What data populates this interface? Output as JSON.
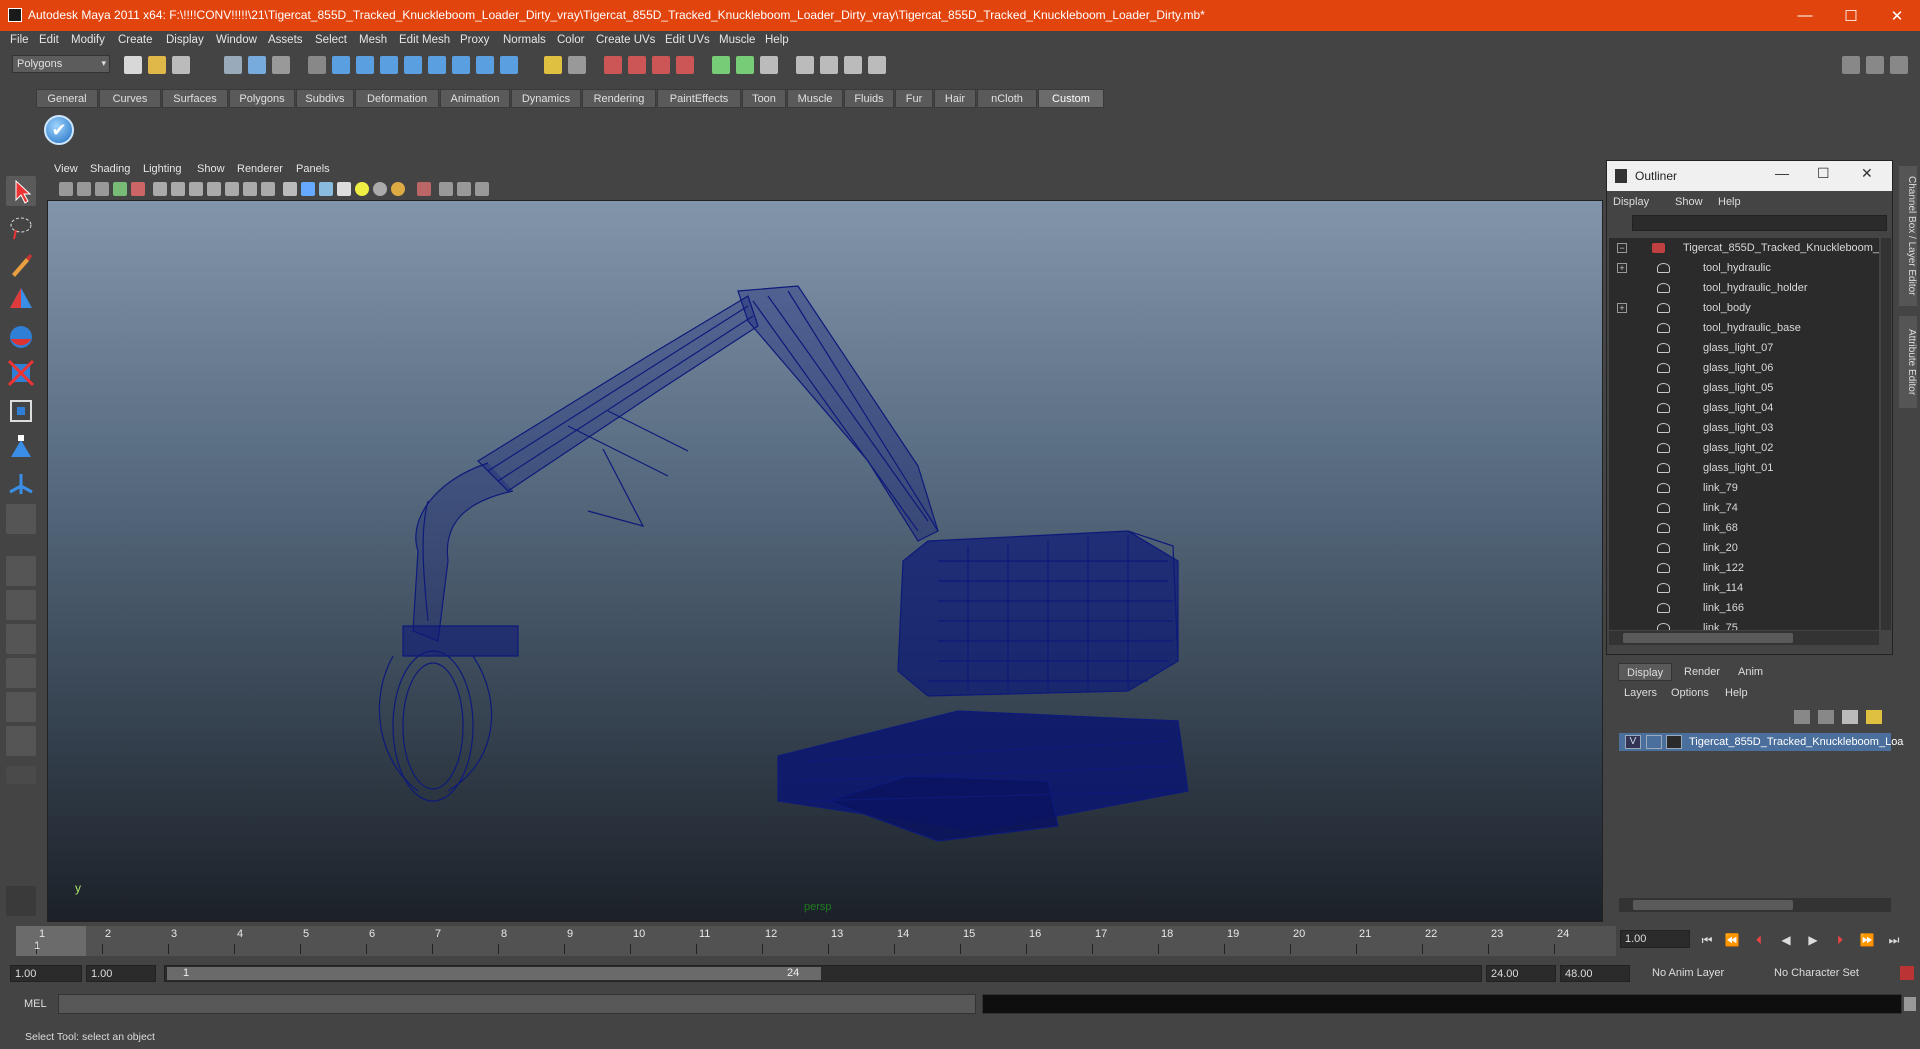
{
  "window": {
    "title": "Autodesk Maya 2011 x64: F:\\!!!!CONV!!!!!\\21\\Tigercat_855D_Tracked_Knuckleboom_Loader_Dirty_vray\\Tigercat_855D_Tracked_Knuckleboom_Loader_Dirty_vray\\Tigercat_855D_Tracked_Knuckleboom_Loader_Dirty.mb*",
    "minimize": "—",
    "maximize": "☐",
    "close": "✕"
  },
  "menu": [
    "File",
    "Edit",
    "Modify",
    "Create",
    "Display",
    "Window",
    "Assets",
    "Select",
    "Mesh",
    "Edit Mesh",
    "Proxy",
    "Normals",
    "Color",
    "Create UVs",
    "Edit UVs",
    "Muscle",
    "Help"
  ],
  "toolbar": {
    "mode": "Polygons",
    "mode_arrow": "▾"
  },
  "shelf": {
    "tabs": [
      "General",
      "Curves",
      "Surfaces",
      "Polygons",
      "Subdivs",
      "Deformation",
      "Animation",
      "Dynamics",
      "Rendering",
      "PaintEffects",
      "Toon",
      "Muscle",
      "Fluids",
      "Fur",
      "Hair",
      "nCloth",
      "Custom"
    ],
    "active_tab": "Custom",
    "button_glyph": "✔"
  },
  "viewport": {
    "menu": [
      "View",
      "Shading",
      "Lighting",
      "Show",
      "Renderer",
      "Panels"
    ],
    "camera": "persp",
    "axis_label": "y"
  },
  "outliner": {
    "title": "Outliner",
    "menu": [
      "Display",
      "Show",
      "Help"
    ],
    "root": "Tigercat_855D_Tracked_Knuckleboom_L",
    "items": [
      "tool_hydraulic",
      "tool_hydraulic_holder",
      "tool_body",
      "tool_hydraulic_base",
      "glass_light_07",
      "glass_light_06",
      "glass_light_05",
      "glass_light_04",
      "glass_light_03",
      "glass_light_02",
      "glass_light_01",
      "link_79",
      "link_74",
      "link_68",
      "link_20",
      "link_122",
      "link_114",
      "link_166",
      "link_75"
    ],
    "expander": "+",
    "collapser": "−"
  },
  "side_tabs": [
    "Channel Box / Layer Editor",
    "Attribute Editor"
  ],
  "layer_editor": {
    "tabs": [
      "Display",
      "Render",
      "Anim"
    ],
    "active_tab": "Display",
    "menu": [
      "Layers",
      "Options",
      "Help"
    ],
    "layer_name": "Tigercat_855D_Tracked_Knuckleboom_Loa",
    "visibility": "V"
  },
  "timeline": {
    "ticks": [
      "1",
      "2",
      "3",
      "4",
      "5",
      "6",
      "7",
      "8",
      "9",
      "10",
      "11",
      "12",
      "13",
      "14",
      "15",
      "16",
      "17",
      "18",
      "19",
      "20",
      "21",
      "22",
      "23",
      "24"
    ],
    "current_frame_label": "1",
    "current_time": "1.00",
    "playback": [
      "⏮",
      "⏪",
      "⏴",
      "◀",
      "▶",
      "⏵",
      "⏩",
      "⏭"
    ]
  },
  "range": {
    "start": "1.00",
    "playback_start": "1.00",
    "slider_start": "1",
    "slider_end": "24",
    "playback_end": "24.00",
    "end": "48.00",
    "anim_layer": "No Anim Layer",
    "character_set": "No Character Set"
  },
  "command": {
    "label": "MEL"
  },
  "help_line": "Select Tool: select an object",
  "colors": {
    "title_bar": "#e2440e",
    "wire": "#0d1a7a",
    "viewport_top": "#8395aa",
    "viewport_bottom": "#1c2128"
  }
}
